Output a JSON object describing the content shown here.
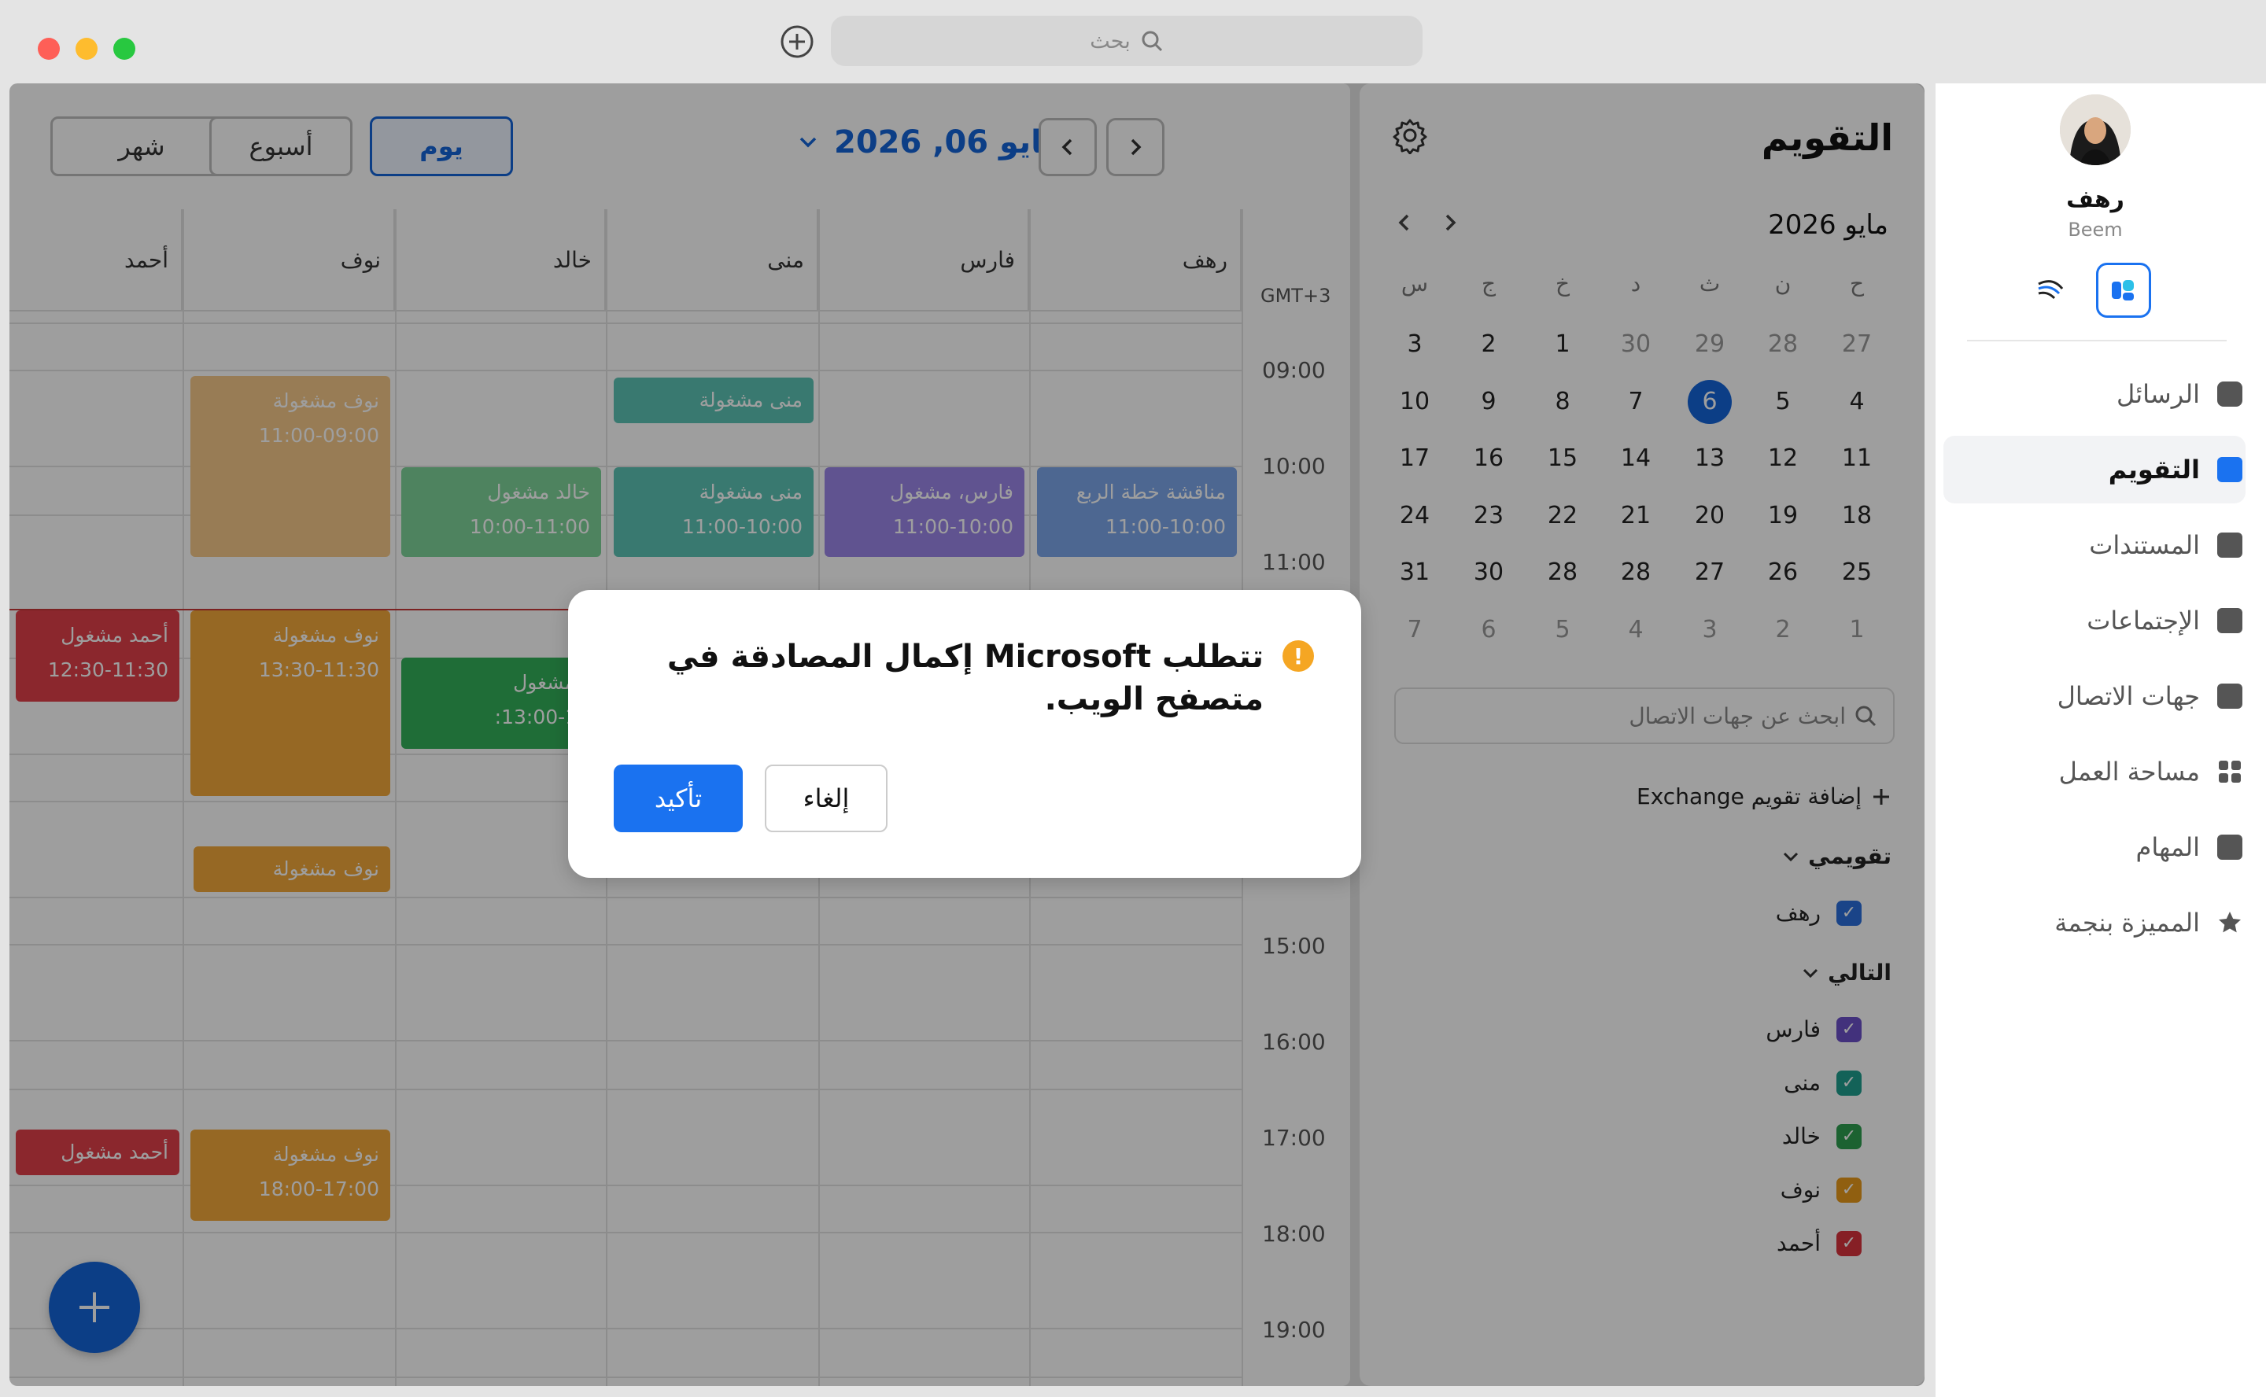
{
  "window": {
    "search_placeholder": "بحث"
  },
  "toolbar": {
    "views": [
      "شهر",
      "أسبوع",
      "يوم"
    ],
    "active_view": "يوم",
    "date_label": "مايو 06, 2026"
  },
  "columns": [
    "أحمد",
    "نوف",
    "خالد",
    "منى",
    "فارس",
    "رهف"
  ],
  "timezone": "GMT+3",
  "times": [
    "09:00",
    "10:00",
    "11:00",
    "15:00",
    "16:00",
    "17:00",
    "18:00",
    "19:00"
  ],
  "events": {
    "nouf1": {
      "title": "نوف مشغولة",
      "time": "11:00-09:00"
    },
    "mona1": {
      "title": "منى مشغولة"
    },
    "khalid1": {
      "title": "خالد مشغول",
      "time": "10:00-11:00"
    },
    "mona2": {
      "title": "منى مشغولة",
      "time": "11:00-10:00"
    },
    "fares1": {
      "title": "فارس، مشغول",
      "time": "11:00-10:00"
    },
    "rahaf1": {
      "title": "مناقشة خطة الربع",
      "time": "11:00-10:00"
    },
    "ahmed1": {
      "title": "أحمد مشغول",
      "time": "12:30-11:30"
    },
    "nouf2": {
      "title": "نوف مشغولة",
      "time": "13:30-11:30"
    },
    "khalid2": {
      "title": "د مشغول",
      "time": "13:00-12:"
    },
    "nouf3": {
      "title": "نوف مشغولة"
    },
    "ahmed2": {
      "title": "أحمد مشغول"
    },
    "nouf4": {
      "title": "نوف مشغولة",
      "time": "18:00-17:00"
    }
  },
  "right_panel": {
    "title": "التقويم",
    "month_label": "مايو 2026",
    "weekdays": [
      "ح",
      "ن",
      "ث",
      "د",
      "خ",
      "ج",
      "س"
    ],
    "weeks": [
      [
        "27",
        "28",
        "29",
        "30",
        "1",
        "2",
        "3"
      ],
      [
        "4",
        "5",
        "6",
        "7",
        "8",
        "9",
        "10"
      ],
      [
        "11",
        "12",
        "13",
        "14",
        "15",
        "16",
        "17"
      ],
      [
        "18",
        "19",
        "20",
        "21",
        "22",
        "23",
        "24"
      ],
      [
        "25",
        "26",
        "27",
        "28",
        "28",
        "30",
        "31"
      ],
      [
        "1",
        "2",
        "3",
        "4",
        "5",
        "6",
        "7"
      ]
    ],
    "contact_search_placeholder": "ابحث عن جهات الاتصال",
    "add_exchange": "إضافة تقويم Exchange",
    "my_calendars_label": "تقويمي",
    "my_calendars": [
      "رهف"
    ],
    "following_label": "التالي",
    "following": [
      {
        "name": "فارس",
        "color": "#6b4fc8"
      },
      {
        "name": "منى",
        "color": "#1f9e8f"
      },
      {
        "name": "خالد",
        "color": "#2e9e4f"
      },
      {
        "name": "نوف",
        "color": "#e89a1a"
      },
      {
        "name": "أحمد",
        "color": "#d8323c"
      }
    ],
    "my_color": "#2a6fdb"
  },
  "sidebar": {
    "user_name": "رهف",
    "org_name": "Beem",
    "items": [
      "الرسائل",
      "التقويم",
      "المستندات",
      "الإجتماعات",
      "جهات الاتصال",
      "مساحة العمل",
      "المهام",
      "المميزة بنجمة"
    ],
    "active_item": "التقويم"
  },
  "modal": {
    "message": "تتطلب Microsoft إكمال المصادقة في متصفح الويب.",
    "cancel_label": "إلغاء",
    "confirm_label": "تأكيد"
  },
  "colors": {
    "accent": "#1464d8",
    "confirm": "#1a72f0",
    "warning": "#f5a623"
  }
}
